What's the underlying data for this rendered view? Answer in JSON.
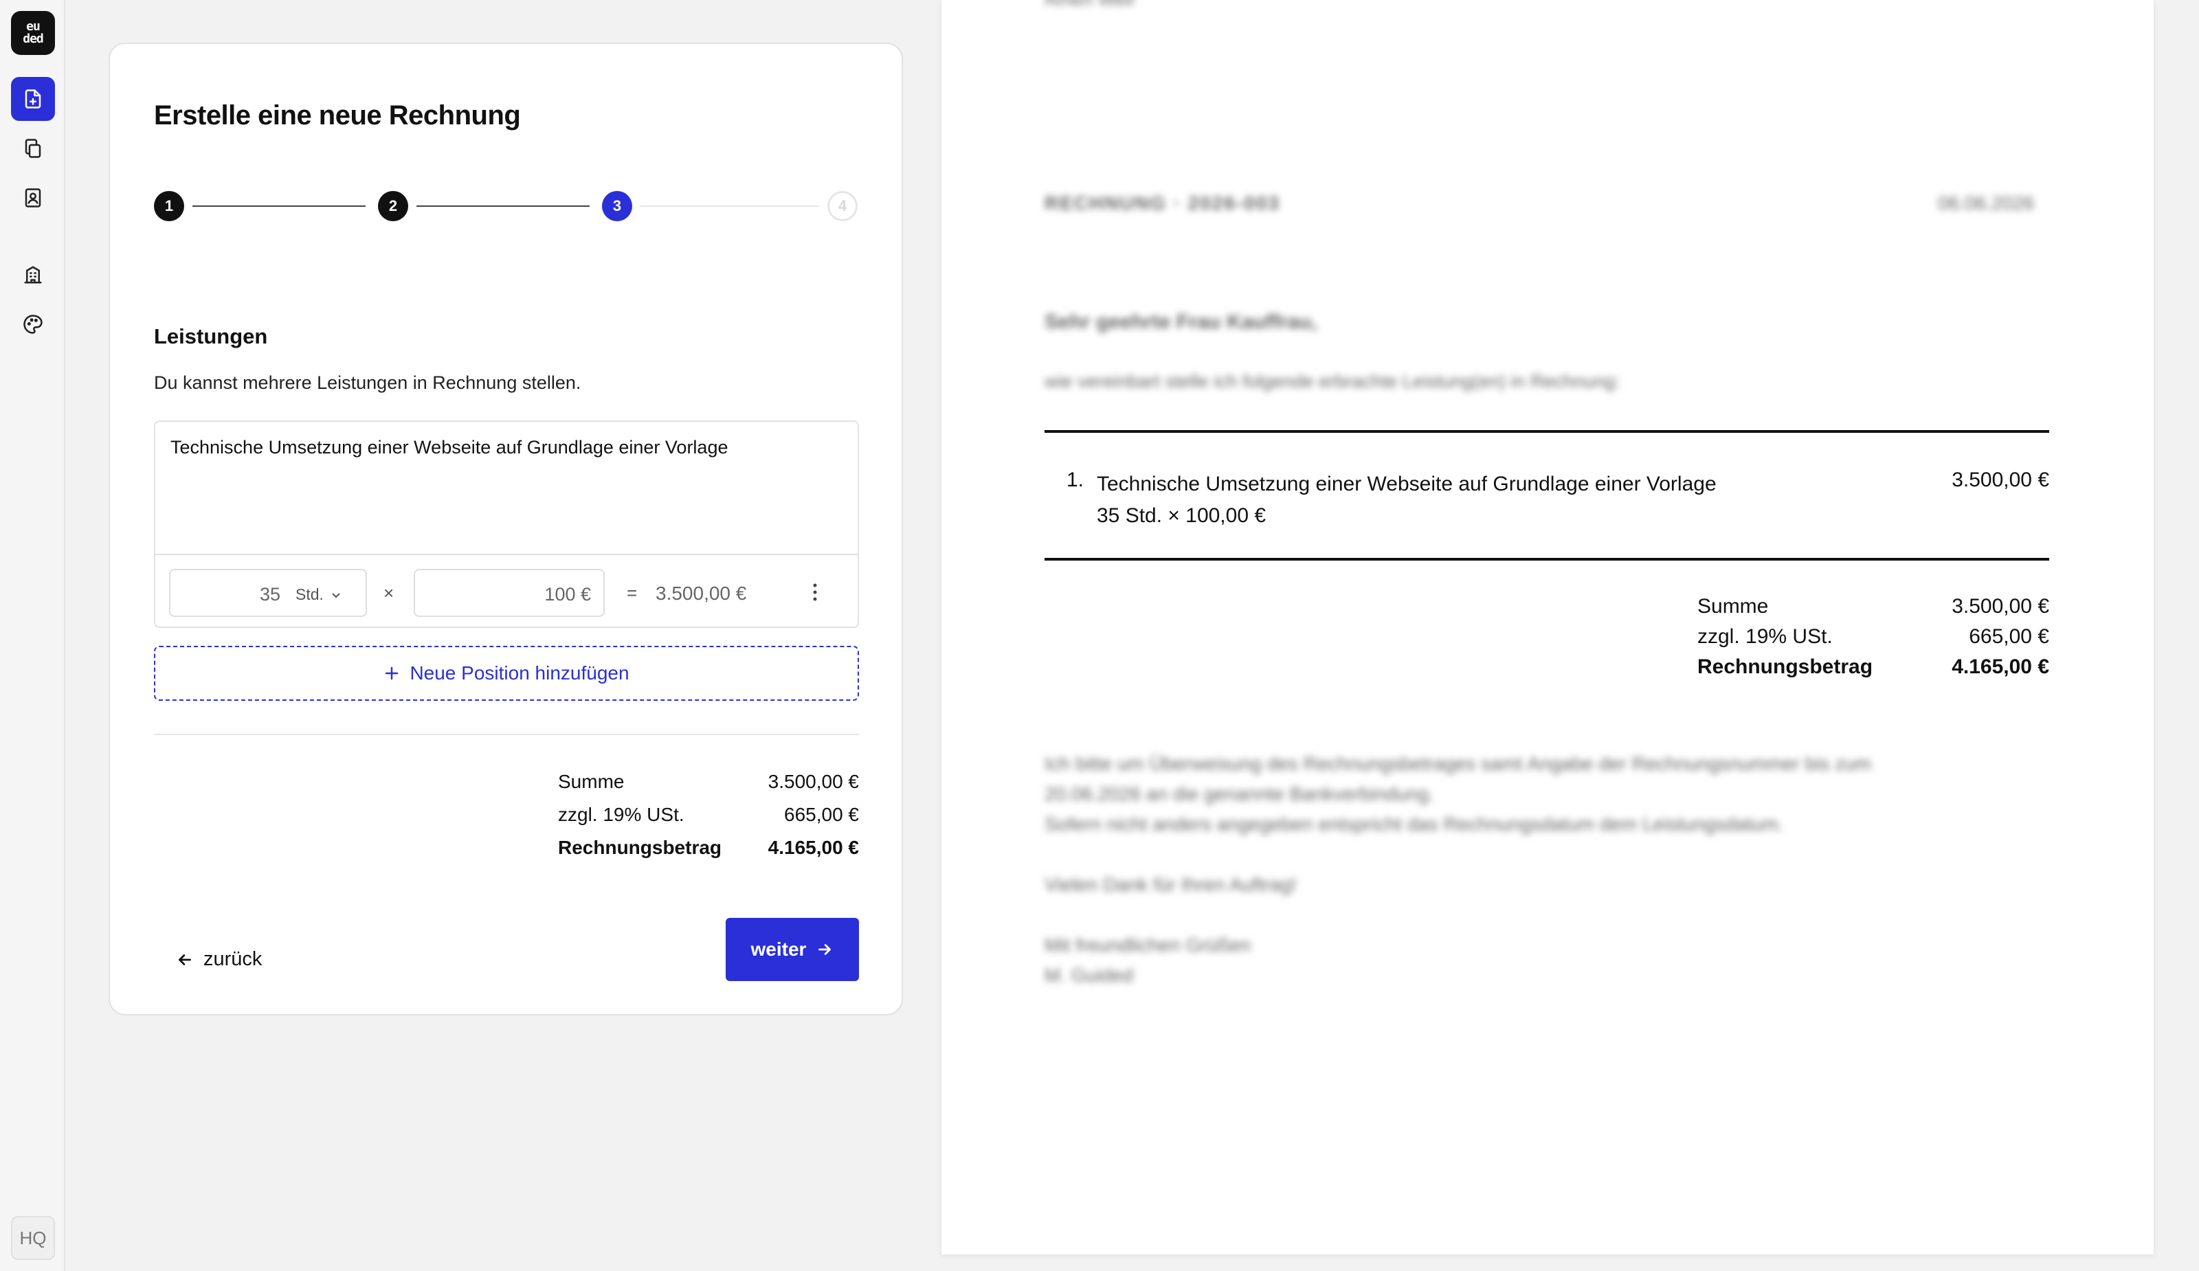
{
  "sidebar": {
    "logo_lines": [
      "eu",
      "ded"
    ],
    "nav": [
      {
        "name": "new-invoice",
        "icon": "file-plus-icon",
        "active": true
      },
      {
        "name": "documents",
        "icon": "copy-icon",
        "active": false
      },
      {
        "name": "contacts",
        "icon": "contact-book-icon",
        "active": false
      },
      {
        "name": "company",
        "icon": "building-icon",
        "active": false
      },
      {
        "name": "theme",
        "icon": "palette-icon",
        "active": false
      }
    ],
    "bottom_label": "HQ"
  },
  "form": {
    "title": "Erstelle eine neue Rechnung",
    "steps": [
      {
        "label": "1",
        "state": "done"
      },
      {
        "label": "2",
        "state": "done"
      },
      {
        "label": "3",
        "state": "current"
      },
      {
        "label": "4",
        "state": "pending"
      }
    ],
    "section_title": "Leistungen",
    "section_desc": "Du kannst mehrere Leistungen in Rechnung stellen.",
    "position": {
      "description": "Technische Umsetzung einer Webseite auf Grundlage einer Vorlage",
      "quantity": "35",
      "unit": "Std.",
      "times": "×",
      "price": "100 €",
      "equals": "=",
      "total": "3.500,00 €"
    },
    "add_label": "Neue Position hinzufügen",
    "totals": {
      "sum_label": "Summe",
      "sum_value": "3.500,00 €",
      "vat_label": "zzgl. 19% USt.",
      "vat_value": "665,00 €",
      "total_label": "Rechnungsbetrag",
      "total_value": "4.165,00 €"
    },
    "back_label": "zurück",
    "next_label": "weiter"
  },
  "preview": {
    "top_text": "Amen Weil",
    "heading": "RECHNUNG · 2026-003",
    "date": "06.06.2026",
    "greeting": "Sehr geehrte Frau Kauffrau,",
    "intro": "wie vereinbart stelle ich folgende erbrachte Leistung(en) in Rechnung:",
    "item_no": "1.",
    "item_desc": "Technische Umsetzung einer Webseite auf Grundlage einer Vorlage",
    "item_detail": "35 Std. × 100,00 €",
    "item_amount": "3.500,00 €",
    "totals": {
      "sum_label": "Summe",
      "sum_value": "3.500,00 €",
      "vat_label": "zzgl. 19% USt.",
      "vat_value": "665,00 €",
      "total_label": "Rechnungsbetrag",
      "total_value": "4.165,00 €"
    },
    "closing": [
      "Ich bitte um Überweisung des Rechnungsbetrages samt Angabe der Rechnungsnummer bis zum",
      "20.06.2026 an die genannte Bankverbindung.",
      "Sofern nicht anders angegeben entspricht das Rechnungsdatum dem Leistungsdatum.",
      "",
      "Vielen Dank für Ihren Auftrag!",
      "",
      "Mit freundlichen Grüßen",
      "M. Guided"
    ]
  },
  "colors": {
    "accent": "#2a2fd8",
    "text": "#111111",
    "border": "#e2e2e2"
  }
}
